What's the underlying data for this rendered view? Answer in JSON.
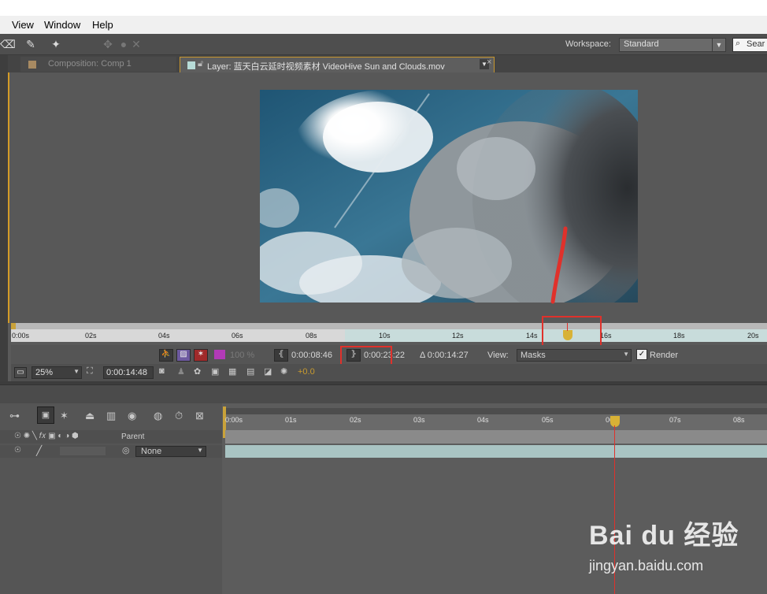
{
  "menu": {
    "items": [
      "View",
      "Window",
      "Help"
    ]
  },
  "workspace": {
    "label": "Workspace:",
    "value": "Standard"
  },
  "search": {
    "placeholder": "Sear"
  },
  "tabs": {
    "composition": "Composition: Comp 1",
    "layer": "Layer: 蓝天白云延时视频素材 VideoHive Sun and Clouds.mov"
  },
  "layer_ruler": {
    "ticks": [
      "0:00s",
      "02s",
      "04s",
      "06s",
      "08s",
      "10s",
      "12s",
      "14s",
      "16s",
      "18s",
      "20s"
    ]
  },
  "layer_controls": {
    "opacity": "100 %",
    "in_time": "0:00:08:46",
    "out_time": "0:00:23:22",
    "duration": "Δ 0:00:14:27",
    "view_label": "View:",
    "view_value": "Masks",
    "render_label": "Render",
    "zoom": "25%",
    "current_time": "0:00:14:48",
    "exposure": "+0.0"
  },
  "timeline": {
    "parent_label": "Parent",
    "parent_value": "None",
    "ticks": [
      "0:00s",
      "01s",
      "02s",
      "03s",
      "04s",
      "05s",
      "06s",
      "07s",
      "08s"
    ]
  },
  "watermark": {
    "brand": "Bai du 经验",
    "url": "jingyan.baidu.com"
  },
  "colors": {
    "accent": "#d39b27",
    "annotation": "#e0312b",
    "track": "#a9c4c3"
  }
}
